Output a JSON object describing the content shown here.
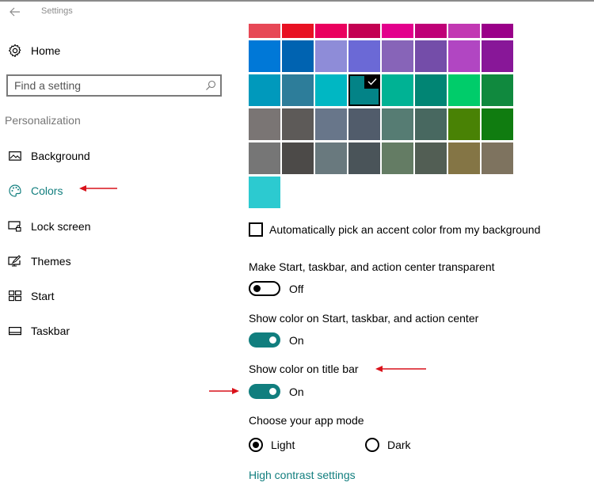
{
  "window": {
    "title": "Settings"
  },
  "sidebar": {
    "home_label": "Home",
    "search_placeholder": "Find a setting",
    "section_header": "Personalization",
    "items": [
      {
        "label": "Background",
        "icon": "picture-icon",
        "active": false
      },
      {
        "label": "Colors",
        "icon": "palette-icon",
        "active": true
      },
      {
        "label": "Lock screen",
        "icon": "lock-screen-icon",
        "active": false
      },
      {
        "label": "Themes",
        "icon": "themes-icon",
        "active": false
      },
      {
        "label": "Start",
        "icon": "start-tiles-icon",
        "active": false
      },
      {
        "label": "Taskbar",
        "icon": "taskbar-icon",
        "active": false
      }
    ]
  },
  "accent_colors": {
    "selected": "#038387",
    "rows": [
      [
        "#e74856",
        "#e81123",
        "#ea005e",
        "#c30052",
        "#e3008c",
        "#bf0077",
        "#c239b3",
        "#9a0089"
      ],
      [
        "#0078d7",
        "#0063b1",
        "#8e8cd8",
        "#6b69d6",
        "#8764b8",
        "#744da9",
        "#b146c2",
        "#881798"
      ],
      [
        "#0099bc",
        "#2d7d9a",
        "#00b7c3",
        "#038387",
        "#00b294",
        "#018574",
        "#00cc6a",
        "#10893e"
      ],
      [
        "#7a7574",
        "#5d5a58",
        "#68768a",
        "#515c6b",
        "#567c73",
        "#486860",
        "#498205",
        "#107c10"
      ],
      [
        "#767676",
        "#4c4a48",
        "#69797e",
        "#4a5459",
        "#647c64",
        "#525e54",
        "#847545",
        "#7e735f"
      ],
      [
        "#2ccad0"
      ]
    ]
  },
  "settings": {
    "auto_accent": {
      "label": "Automatically pick an accent color from my background",
      "checked": false
    },
    "transparent": {
      "label": "Make Start, taskbar, and action center transparent",
      "state": "Off"
    },
    "color_start": {
      "label": "Show color on Start, taskbar, and action center",
      "state": "On"
    },
    "color_title": {
      "label": "Show color on title bar",
      "state": "On"
    },
    "app_mode": {
      "label": "Choose your app mode",
      "options": [
        {
          "label": "Light",
          "checked": true
        },
        {
          "label": "Dark",
          "checked": false
        }
      ]
    },
    "high_contrast_link": "High contrast settings"
  },
  "colors": {
    "accent": "#117e7e",
    "annotation_arrow": "#d9121b"
  }
}
